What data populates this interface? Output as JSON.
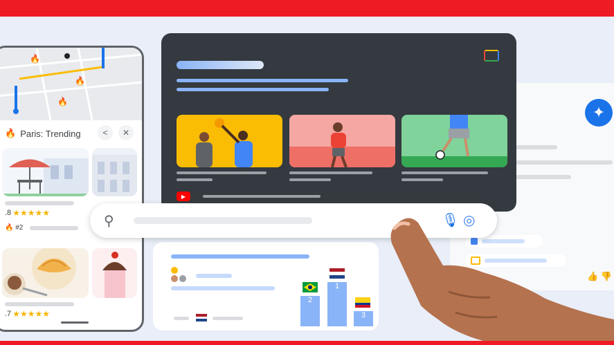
{
  "colors": {
    "brand_red": "#ee1b24",
    "dark_card": "#343a3f",
    "accent_blue": "#1a73e8",
    "highlight_blue": "#8ab4f8",
    "star_yellow": "#f6b400"
  },
  "left_phone": {
    "title": "Paris: Trending",
    "rating_1": ".8",
    "rank_label": "#2",
    "rating_2": ".7",
    "stars": "★★★★★"
  },
  "icons": {
    "search": "search-icon",
    "mic": "mic-icon",
    "lens": "lens-icon",
    "share": "share-icon",
    "close": "close-icon",
    "youtube": "youtube-icon",
    "gemini": "gemini-icon"
  },
  "podium": {
    "places": [
      "2",
      "1",
      "3"
    ]
  }
}
